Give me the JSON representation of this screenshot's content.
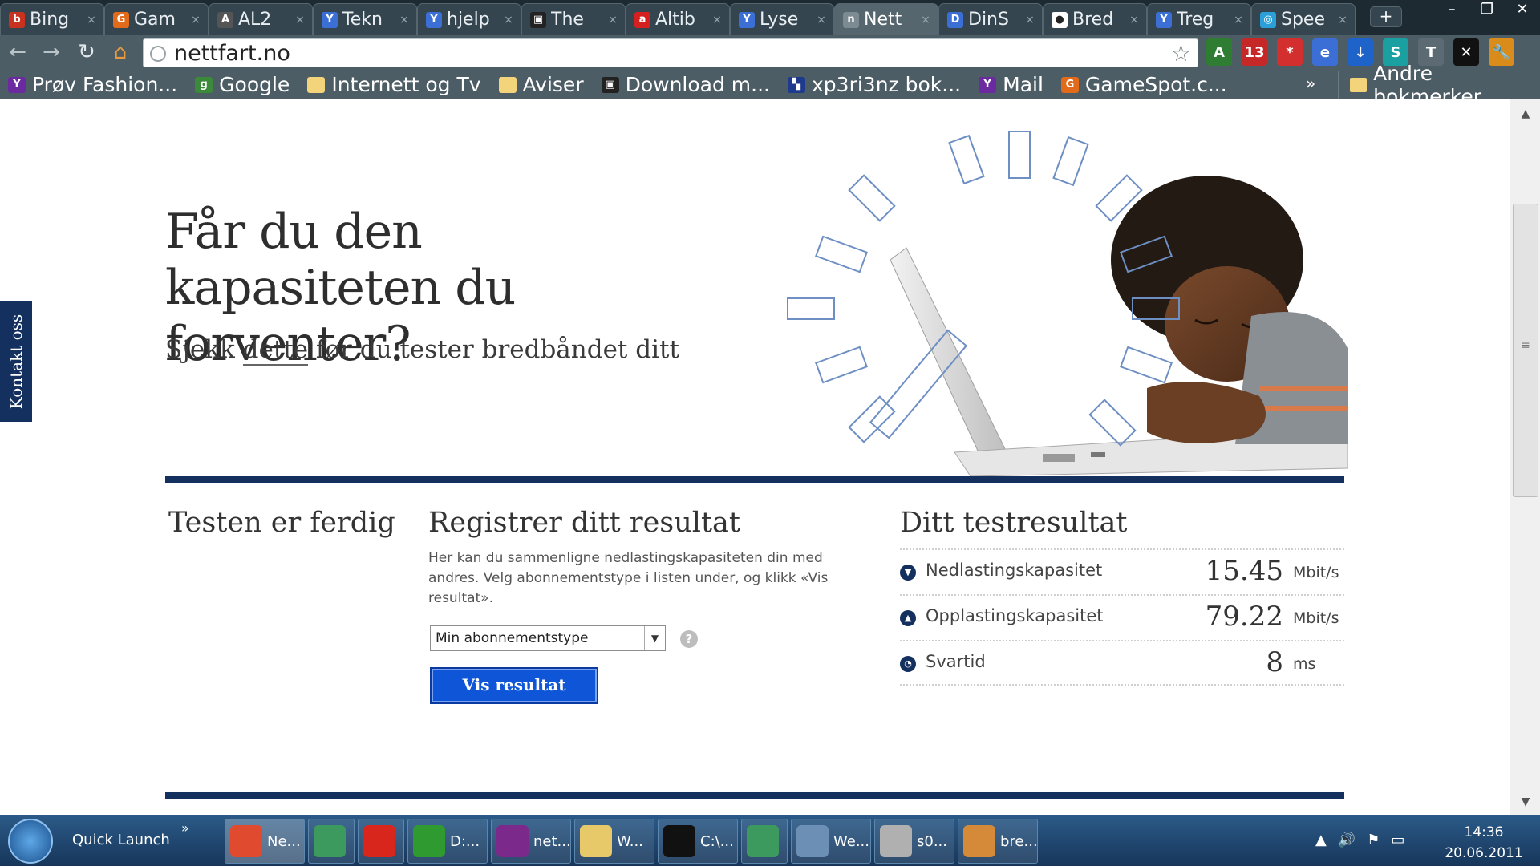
{
  "browser": {
    "tabs": [
      {
        "title": "Bing",
        "icon": "bing-icon",
        "color": "#c8321e",
        "glyph": "b",
        "active": false
      },
      {
        "title": "Gam",
        "icon": "gamespot-icon",
        "color": "#e26a1b",
        "glyph": "G",
        "active": false
      },
      {
        "title": "AL2",
        "icon": "al-icon",
        "color": "#555555",
        "glyph": "A",
        "active": false
      },
      {
        "title": "Tekn",
        "icon": "y-icon",
        "color": "#3b6fd6",
        "glyph": "Y",
        "active": false
      },
      {
        "title": "hjelp",
        "icon": "y-icon",
        "color": "#3b6fd6",
        "glyph": "Y",
        "active": false
      },
      {
        "title": "The",
        "icon": "monitor-icon",
        "color": "#222222",
        "glyph": "▣",
        "active": false
      },
      {
        "title": "Altib",
        "icon": "altibox-icon",
        "color": "#d62020",
        "glyph": "a",
        "active": false
      },
      {
        "title": "Lyse",
        "icon": "y-icon",
        "color": "#3b6fd6",
        "glyph": "Y",
        "active": false
      },
      {
        "title": "Nett",
        "icon": "nettfart-icon",
        "color": "#7c8a92",
        "glyph": "n",
        "active": true
      },
      {
        "title": "DinS",
        "icon": "dins-icon",
        "color": "#3b6fd6",
        "glyph": "D",
        "active": false
      },
      {
        "title": "Bred",
        "icon": "clock-icon",
        "color": "#ffffff",
        "glyph": "●",
        "active": false
      },
      {
        "title": "Treg",
        "icon": "y-icon",
        "color": "#3b6fd6",
        "glyph": "Y",
        "active": false
      },
      {
        "title": "Spee",
        "icon": "speedtest-icon",
        "color": "#2a9fd8",
        "glyph": "◎",
        "active": false
      }
    ],
    "close_glyph": "×",
    "newtab_glyph": "+",
    "window_controls": {
      "minimize": "–",
      "restore": "❐",
      "close": "✕"
    },
    "nav": {
      "back": "←",
      "forward": "→",
      "reload": "↻",
      "home": "⌂"
    },
    "address": "nettfart.no",
    "star_glyph": "☆",
    "extensions": [
      {
        "name": "translate-icon",
        "color": "#2f7d32",
        "glyph": "A"
      },
      {
        "name": "calendar-icon",
        "color": "#c62828",
        "glyph": "13"
      },
      {
        "name": "lastpass-icon",
        "color": "#d32f2f",
        "glyph": "*"
      },
      {
        "name": "tab-icon",
        "color": "#3b6fd6",
        "glyph": "e"
      },
      {
        "name": "download-icon",
        "color": "#1e63c9",
        "glyph": "↓"
      },
      {
        "name": "sync-icon",
        "color": "#1aa0a0",
        "glyph": "S"
      },
      {
        "name": "tag-icon",
        "color": "#5c6b73",
        "glyph": "T"
      },
      {
        "name": "close-x-icon",
        "color": "#111111",
        "glyph": "✕"
      },
      {
        "name": "wrench-icon",
        "color": "#d98c1a",
        "glyph": "🔧"
      }
    ],
    "bookmarks": [
      {
        "label": "Prøv Fashion...",
        "icon": "yahoo-icon",
        "color": "#6b2aa0",
        "glyph": "Y",
        "folder": false
      },
      {
        "label": "Google",
        "icon": "google-icon",
        "color": "#3a8a3a",
        "glyph": "g",
        "folder": false
      },
      {
        "label": "Internett og Tv",
        "icon": "folder-icon",
        "color": "#f4d47a",
        "glyph": "",
        "folder": true
      },
      {
        "label": "Aviser",
        "icon": "folder-icon",
        "color": "#f4d47a",
        "glyph": "",
        "folder": true
      },
      {
        "label": "Download m...",
        "icon": "monitor-icon",
        "color": "#222222",
        "glyph": "▣",
        "folder": false
      },
      {
        "label": "xp3ri3nz bok...",
        "icon": "checker-icon",
        "color": "#1e3a8c",
        "glyph": "▚",
        "folder": false
      },
      {
        "label": "Mail",
        "icon": "yahoo-icon",
        "color": "#6b2aa0",
        "glyph": "Y",
        "folder": false
      },
      {
        "label": "GameSpot.c...",
        "icon": "gamespot-icon",
        "color": "#e26a1b",
        "glyph": "G",
        "folder": false
      }
    ],
    "bookmarks_more": "»",
    "other_bookmarks": "Andre bokmerker"
  },
  "page": {
    "hero": {
      "title": "Får du den kapasiteten du forventer?",
      "subtitle_before": "Sjekk ",
      "subtitle_link": "dette",
      "subtitle_after": " før du tester bredbåndet ditt"
    },
    "done_title": "Testen er ferdig",
    "register": {
      "title": "Registrer ditt resultat",
      "description": "Her kan du sammenligne nedlastingskapasiteten din med andres. Velg abonnementstype i listen under, og klikk «Vis resultat».",
      "select_value": "Min abonnementstype",
      "help": "?",
      "button": "Vis resultat"
    },
    "results": {
      "title": "Ditt testresultat",
      "rows": [
        {
          "label": "Nedlastingskapasitet",
          "value": "15.45",
          "unit": "Mbit/s",
          "icon": "download-arrow-icon",
          "glyph": "▼"
        },
        {
          "label": "Opplastingskapasitet",
          "value": "79.22",
          "unit": "Mbit/s",
          "icon": "upload-arrow-icon",
          "glyph": "▲"
        },
        {
          "label": "Svartid",
          "value": "8",
          "unit": "ms",
          "icon": "clock-icon",
          "glyph": "◔"
        }
      ]
    },
    "contact_tab": "Kontakt oss"
  },
  "taskbar": {
    "quick_launch": "Quick Launch",
    "more": "»",
    "tasks": [
      {
        "label": "Ne...",
        "name": "task-chrome",
        "color": "#e04a2f",
        "active": true,
        "icon_only": false
      },
      {
        "label": "",
        "name": "task-map",
        "color": "#3d9a5e",
        "active": false,
        "icon_only": true
      },
      {
        "label": "",
        "name": "task-s-app",
        "color": "#d8261c",
        "active": false,
        "icon_only": true
      },
      {
        "label": "D:...",
        "name": "task-utorrent",
        "color": "#2f9a2f",
        "active": false,
        "icon_only": false
      },
      {
        "label": "net...",
        "name": "task-winrar",
        "color": "#7b2a8c",
        "active": false,
        "icon_only": false
      },
      {
        "label": "W...",
        "name": "task-explorer",
        "color": "#e8c96a",
        "active": false,
        "icon_only": false
      },
      {
        "label": "C:\\...",
        "name": "task-cmd",
        "color": "#111111",
        "active": false,
        "icon_only": false
      },
      {
        "label": "",
        "name": "task-map2",
        "color": "#3d9a5e",
        "active": false,
        "icon_only": true
      },
      {
        "label": "We...",
        "name": "task-network",
        "color": "#6c8fb5",
        "active": false,
        "icon_only": false
      },
      {
        "label": "s0...",
        "name": "task-video",
        "color": "#b0b0b0",
        "active": false,
        "icon_only": false
      },
      {
        "label": "bre...",
        "name": "task-paint",
        "color": "#d58a3a",
        "active": false,
        "icon_only": false
      }
    ],
    "tray_glyphs": {
      "up": "▲",
      "volume": "🔊",
      "flag": "⚑",
      "network": "▭"
    },
    "time": "14:36",
    "date": "20.06.2011"
  }
}
